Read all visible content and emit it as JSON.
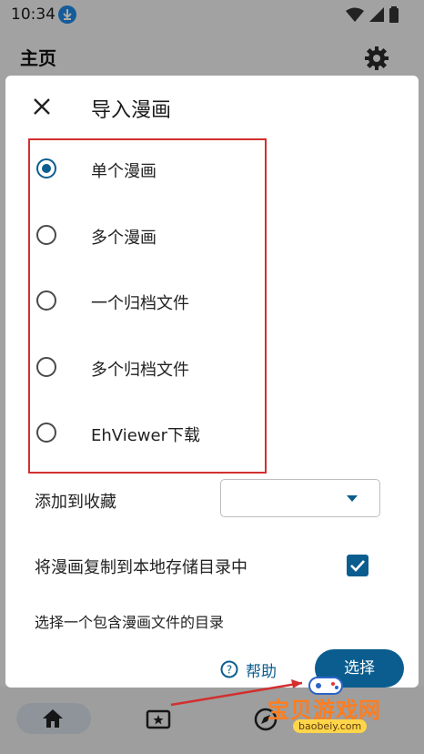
{
  "status_bar": {
    "time": "10:34",
    "download_icon": "download-icon",
    "wifi_icon": "wifi-icon",
    "signal_icon": "signal-icon",
    "battery_icon": "battery-icon"
  },
  "app_bar": {
    "title": "主页",
    "settings_icon": "gear-icon"
  },
  "dialog": {
    "title": "导入漫画",
    "close_icon": "close-icon",
    "options": [
      {
        "label": "单个漫画",
        "selected": true
      },
      {
        "label": "多个漫画",
        "selected": false
      },
      {
        "label": "一个归档文件",
        "selected": false
      },
      {
        "label": "多个归档文件",
        "selected": false
      },
      {
        "label": "EhViewer下载",
        "selected": false
      }
    ],
    "favorite": {
      "label": "添加到收藏",
      "value": ""
    },
    "copy_to_local": {
      "label": "将漫画复制到本地存储目录中",
      "checked": true
    },
    "directory_hint": "选择一个包含漫画文件的目录",
    "help_label": "帮助",
    "select_label": "选择"
  },
  "bottom_nav": {
    "home_icon": "home-icon",
    "ticket_icon": "ticket-star-icon",
    "compass_icon": "compass-icon"
  },
  "watermark": {
    "text": "宝贝游戏网",
    "url": "baobeiy.com"
  },
  "colors": {
    "accent": "#0b5d8f",
    "highlight": "#d32f2f"
  }
}
